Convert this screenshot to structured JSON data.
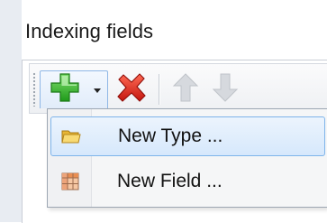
{
  "panel": {
    "title": "Indexing fields"
  },
  "toolbar": {
    "add_icon": "green-plus-icon",
    "dropdown_icon": "dropdown-arrow-icon",
    "delete_icon": "red-x-icon",
    "move_up_icon": "up-arrow-icon",
    "move_down_icon": "down-arrow-icon",
    "move_up_state": "disabled",
    "move_down_state": "disabled"
  },
  "menu": {
    "items": [
      {
        "label": "New Type ...",
        "icon": "folder-icon",
        "highlighted": true
      },
      {
        "label": "New Field ...",
        "icon": "table-grid-icon",
        "highlighted": false
      }
    ]
  },
  "colors": {
    "add_green": "#35b52c",
    "delete_red": "#d9231b",
    "highlight_border": "#7eb4ea",
    "highlight_fill": "#d6e8fc"
  }
}
